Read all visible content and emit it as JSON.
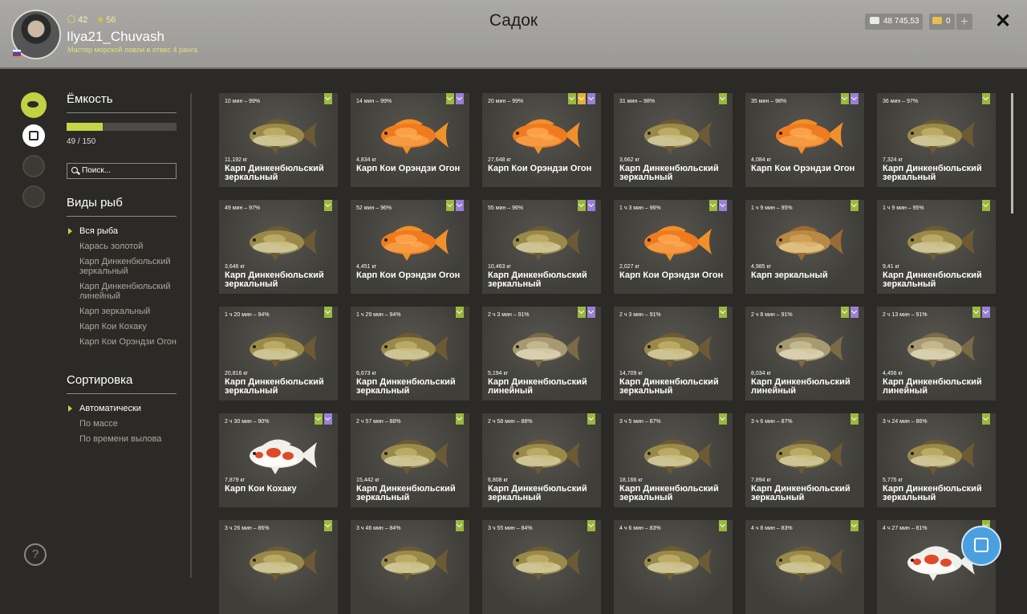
{
  "header": {
    "level": "42",
    "stars": "56",
    "username": "Ilya21_Chuvash",
    "rank": "Мастер морской ловли в отвес 4 ранга",
    "title": "Садок",
    "money": "48 745,53",
    "gold": "0",
    "plus": "+",
    "close": "✕"
  },
  "sidebar": {
    "capacity_title": "Ёмкость",
    "capacity_text": "49 / 150",
    "capacity_fraction": 0.327,
    "search_placeholder": "Поиск...",
    "species_title": "Виды рыб",
    "species": [
      {
        "label": "Вся рыба",
        "selected": true
      },
      {
        "label": "Карась золотой",
        "selected": false
      },
      {
        "label": "Карп Динкенбюльский зеркальный",
        "selected": false
      },
      {
        "label": "Карп Динкенбюльский линейный",
        "selected": false
      },
      {
        "label": "Карп зеркальный",
        "selected": false
      },
      {
        "label": "Карп Кои Кохаку",
        "selected": false
      },
      {
        "label": "Карп Кои Орэндзи Огон",
        "selected": false
      }
    ],
    "sort_title": "Сортировка",
    "sort": [
      {
        "label": "Автоматически",
        "selected": true
      },
      {
        "label": "По массе",
        "selected": false
      },
      {
        "label": "По времени вылова",
        "selected": false
      }
    ],
    "help": "?"
  },
  "fish": [
    {
      "time": "10 мин – 99%",
      "weight": "11,192 кг",
      "name": "Карп Динкенбюльский зеркальный",
      "kind": "mirror",
      "badges": [
        "g"
      ]
    },
    {
      "time": "14 мин – 99%",
      "weight": "4,834 кг",
      "name": "Карп Кои Орэндзи Огон",
      "kind": "orange",
      "badges": [
        "g",
        "p"
      ]
    },
    {
      "time": "20 мин – 99%",
      "weight": "27,648 кг",
      "name": "Карп Кои Орэндзи Огон",
      "kind": "orange",
      "badges": [
        "g",
        "y",
        "p"
      ]
    },
    {
      "time": "31 мин – 98%",
      "weight": "3,662 кг",
      "name": "Карп Динкенбюльский зеркальный",
      "kind": "mirror",
      "badges": [
        "g"
      ]
    },
    {
      "time": "35 мин – 98%",
      "weight": "4,084 кг",
      "name": "Карп Кои Орэндзи Огон",
      "kind": "orange",
      "badges": [
        "g",
        "p"
      ]
    },
    {
      "time": "36 мин – 97%",
      "weight": "7,324 кг",
      "name": "Карп Динкенбюльский зеркальный",
      "kind": "mirror",
      "badges": [
        "g"
      ]
    },
    {
      "time": "49 мин – 97%",
      "weight": "3,646 кг",
      "name": "Карп Динкенбюльский зеркальный",
      "kind": "mirror",
      "badges": [
        "g"
      ]
    },
    {
      "time": "52 мин – 96%",
      "weight": "4,451 кг",
      "name": "Карп Кои Орэндзи Огон",
      "kind": "orange",
      "badges": [
        "g",
        "p"
      ]
    },
    {
      "time": "55 мин – 96%",
      "weight": "10,463 кг",
      "name": "Карп Динкенбюльский зеркальный",
      "kind": "mirror",
      "badges": [
        "g",
        "p"
      ]
    },
    {
      "time": "1 ч 3 мин – 96%",
      "weight": "2,027 кг",
      "name": "Карп Кои Орэндзи Огон",
      "kind": "orange",
      "badges": [
        "g",
        "p"
      ]
    },
    {
      "time": "1 ч 9 мин – 95%",
      "weight": "4,985 кг",
      "name": "Карп зеркальный",
      "kind": "golden",
      "badges": [
        "g"
      ]
    },
    {
      "time": "1 ч 9 мин – 95%",
      "weight": "9,41 кг",
      "name": "Карп Динкенбюльский зеркальный",
      "kind": "mirror",
      "badges": [
        "g"
      ]
    },
    {
      "time": "1 ч 20 мин – 94%",
      "weight": "20,816 кг",
      "name": "Карп Динкенбюльский зеркальный",
      "kind": "mirror",
      "badges": [
        "g"
      ]
    },
    {
      "time": "1 ч 29 мин – 94%",
      "weight": "6,673 кг",
      "name": "Карп Динкенбюльский зеркальный",
      "kind": "mirror",
      "badges": [
        "g"
      ]
    },
    {
      "time": "2 ч 3 мин – 91%",
      "weight": "5,194 кг",
      "name": "Карп Динкенбюльский линейный",
      "kind": "linear",
      "badges": [
        "g",
        "p"
      ]
    },
    {
      "time": "2 ч 3 мин – 91%",
      "weight": "14,709 кг",
      "name": "Карп Динкенбюльский зеркальный",
      "kind": "mirror",
      "badges": [
        "g"
      ]
    },
    {
      "time": "2 ч 8 мин – 91%",
      "weight": "8,034 кг",
      "name": "Карп Динкенбюльский линейный",
      "kind": "linear",
      "badges": [
        "g",
        "p"
      ]
    },
    {
      "time": "2 ч 13 мин – 91%",
      "weight": "4,456 кг",
      "name": "Карп Динкенбюльский линейный",
      "kind": "linear",
      "badges": [
        "g",
        "p"
      ]
    },
    {
      "time": "2 ч 30 мин – 90%",
      "weight": "7,879 кг",
      "name": "Карп Кои Кохаку",
      "kind": "kohaku",
      "badges": [
        "g",
        "p"
      ]
    },
    {
      "time": "2 ч 57 мин – 88%",
      "weight": "15,442 кг",
      "name": "Карп Динкенбюльский зеркальный",
      "kind": "mirror",
      "badges": [
        "g"
      ]
    },
    {
      "time": "2 ч 58 мин – 88%",
      "weight": "6,808 кг",
      "name": "Карп Динкенбюльский зеркальный",
      "kind": "mirror",
      "badges": [
        "g"
      ]
    },
    {
      "time": "3 ч 5 мин – 87%",
      "weight": "18,166 кг",
      "name": "Карп Динкенбюльский зеркальный",
      "kind": "mirror",
      "badges": [
        "g"
      ]
    },
    {
      "time": "3 ч 6 мин – 87%",
      "weight": "7,894 кг",
      "name": "Карп Динкенбюльский зеркальный",
      "kind": "mirror",
      "badges": [
        "g"
      ]
    },
    {
      "time": "3 ч 24 мин – 86%",
      "weight": "5,775 кг",
      "name": "Карп Динкенбюльский зеркальный",
      "kind": "mirror",
      "badges": [
        "g"
      ]
    },
    {
      "time": "3 ч 26 мин – 86%",
      "weight": "",
      "name": "",
      "kind": "mirror",
      "badges": [
        "g"
      ]
    },
    {
      "time": "3 ч 46 мин – 84%",
      "weight": "",
      "name": "",
      "kind": "mirror",
      "badges": [
        "g"
      ]
    },
    {
      "time": "3 ч 55 мин – 84%",
      "weight": "",
      "name": "",
      "kind": "mirror",
      "badges": [
        "g"
      ]
    },
    {
      "time": "4 ч 6 мин – 83%",
      "weight": "",
      "name": "",
      "kind": "mirror",
      "badges": [
        "g"
      ]
    },
    {
      "time": "4 ч 8 мин – 83%",
      "weight": "",
      "name": "",
      "kind": "mirror",
      "badges": [
        "g"
      ]
    },
    {
      "time": "4 ч 27 мин – 81%",
      "weight": "",
      "name": "",
      "kind": "kohaku",
      "badges": [
        "g"
      ]
    }
  ],
  "colors": {
    "accent": "#c6d545",
    "badge_green": "#9ab83e",
    "badge_purple": "#9a7fd6",
    "badge_gold": "#e0b43a"
  }
}
